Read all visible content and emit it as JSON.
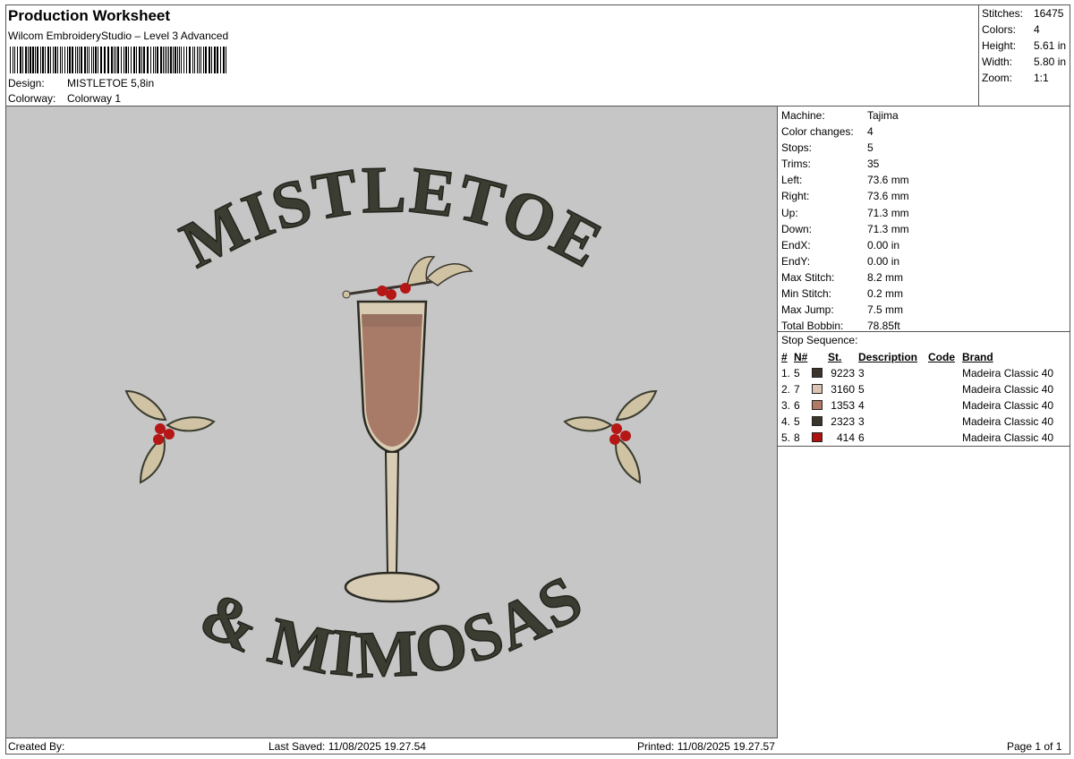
{
  "header": {
    "title": "Production Worksheet",
    "subtitle": "Wilcom EmbroideryStudio – Level 3 Advanced",
    "design_label": "Design:",
    "design_value": "MISTLETOE 5,8in",
    "colorway_label": "Colorway:",
    "colorway_value": "Colorway 1"
  },
  "stats": [
    {
      "label": "Stitches:",
      "value": "16475"
    },
    {
      "label": "Colors:",
      "value": "4"
    },
    {
      "label": "Height:",
      "value": "5.61 in"
    },
    {
      "label": "Width:",
      "value": "5.80 in"
    },
    {
      "label": "Zoom:",
      "value": "1:1"
    }
  ],
  "artwork": {
    "top_text": "MISTLETOE",
    "bottom_text": "& MIMOSAS",
    "colors": {
      "background": "#c6c6c6",
      "thread_dark": "#3c3d32",
      "thread_outline": "#2b2b24",
      "glass_fill": "#a87a68",
      "glass_stem": "#d8ccb4",
      "leaf": "#cfc3a3",
      "berry": "#b51616"
    }
  },
  "machine": [
    {
      "label": "Machine:",
      "value": "Tajima"
    },
    {
      "label": "Color changes:",
      "value": "4"
    },
    {
      "label": "Stops:",
      "value": "5"
    },
    {
      "label": "Trims:",
      "value": "35"
    },
    {
      "label": "Left:",
      "value": "73.6 mm"
    },
    {
      "label": "Right:",
      "value": "73.6 mm"
    },
    {
      "label": "Up:",
      "value": "71.3 mm"
    },
    {
      "label": "Down:",
      "value": "71.3 mm"
    },
    {
      "label": "EndX:",
      "value": "0.00 in"
    },
    {
      "label": "EndY:",
      "value": "0.00 in"
    },
    {
      "label": "Max Stitch:",
      "value": "8.2 mm"
    },
    {
      "label": "Min Stitch:",
      "value": "0.2 mm"
    },
    {
      "label": "Max Jump:",
      "value": "7.5 mm"
    },
    {
      "label": "Total Bobbin:",
      "value": "78.85ft"
    }
  ],
  "stop_sequence": {
    "caption": "Stop Sequence:",
    "columns": {
      "num": "#",
      "n": "N#",
      "st": "St.",
      "desc": "Description",
      "code": "Code",
      "brand": "Brand"
    },
    "rows": [
      {
        "num": "1.",
        "n": "5",
        "color": "#3a342c",
        "st": "9223",
        "desc": "3",
        "code": "",
        "brand": "Madeira Classic 40"
      },
      {
        "num": "2.",
        "n": "7",
        "color": "#dcc4b4",
        "st": "3160",
        "desc": "5",
        "code": "",
        "brand": "Madeira Classic 40"
      },
      {
        "num": "3.",
        "n": "6",
        "color": "#b07a64",
        "st": "1353",
        "desc": "4",
        "code": "",
        "brand": "Madeira Classic 40"
      },
      {
        "num": "4.",
        "n": "5",
        "color": "#3a342c",
        "st": "2323",
        "desc": "3",
        "code": "",
        "brand": "Madeira Classic 40"
      },
      {
        "num": "5.",
        "n": "8",
        "color": "#b01010",
        "st": "414",
        "desc": "6",
        "code": "",
        "brand": "Madeira Classic 40"
      }
    ]
  },
  "footer": {
    "created_by": "Created By:",
    "last_saved": "Last Saved: 11/08/2025 19.27.54",
    "printed": "Printed: 11/08/2025 19.27.57",
    "page": "Page 1 of 1"
  }
}
